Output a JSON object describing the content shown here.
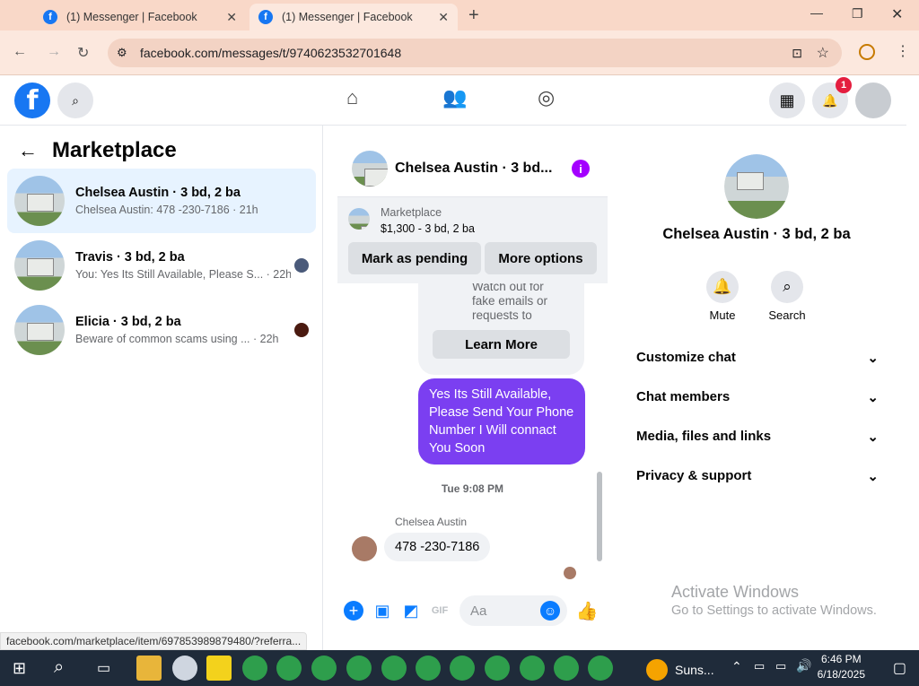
{
  "browser": {
    "tabs": [
      {
        "title": "(1) Messenger | Facebook"
      },
      {
        "title": "(1) Messenger | Facebook"
      }
    ],
    "url": "facebook.com/messages/t/9740623532701648",
    "status_url": "facebook.com/marketplace/item/697853989879480/?referra..."
  },
  "fb": {
    "logo": "f",
    "notifications": "1"
  },
  "left": {
    "title": "Marketplace",
    "conversations": [
      {
        "name": "Chelsea Austin · 3 bd, 2 ba",
        "preview": "Chelsea Austin: 478 -230-7186 · 21h"
      },
      {
        "name": "Travis · 3 bd, 2 ba",
        "preview": "You: Yes Its Still Available, Please S... · 22h"
      },
      {
        "name": "Elicia · 3 bd, 2 ba",
        "preview": "Beware of common scams using ... · 22h"
      }
    ]
  },
  "chat": {
    "title": "Chelsea Austin · 3 bd...",
    "marketplace_label": "Marketplace",
    "listing": "$1,300 - 3 bd, 2 ba",
    "btn_pending": "Mark as pending",
    "btn_more": "More options",
    "scam_text": "Watch out for fake emails or requests to upgrade your ...",
    "learn_more": "Learn More",
    "my_message": "Yes Its Still Available, Please Send Your Phone Number I Will connact You Soon",
    "timestamp": "Tue 9:08 PM",
    "sender": "Chelsea Austin",
    "their_message": "478 -230-7186",
    "input_placeholder": "Aa"
  },
  "details": {
    "name": "Chelsea Austin · 3 bd, 2 ba",
    "mute": "Mute",
    "search": "Search",
    "sections": [
      "Customize chat",
      "Chat members",
      "Media, files and links",
      "Privacy & support"
    ]
  },
  "watermark": {
    "line1": "Activate Windows",
    "line2": "Go to Settings to activate Windows."
  },
  "taskbar": {
    "weather": "Suns...",
    "time": "6:46 PM",
    "date": "6/18/2025"
  }
}
